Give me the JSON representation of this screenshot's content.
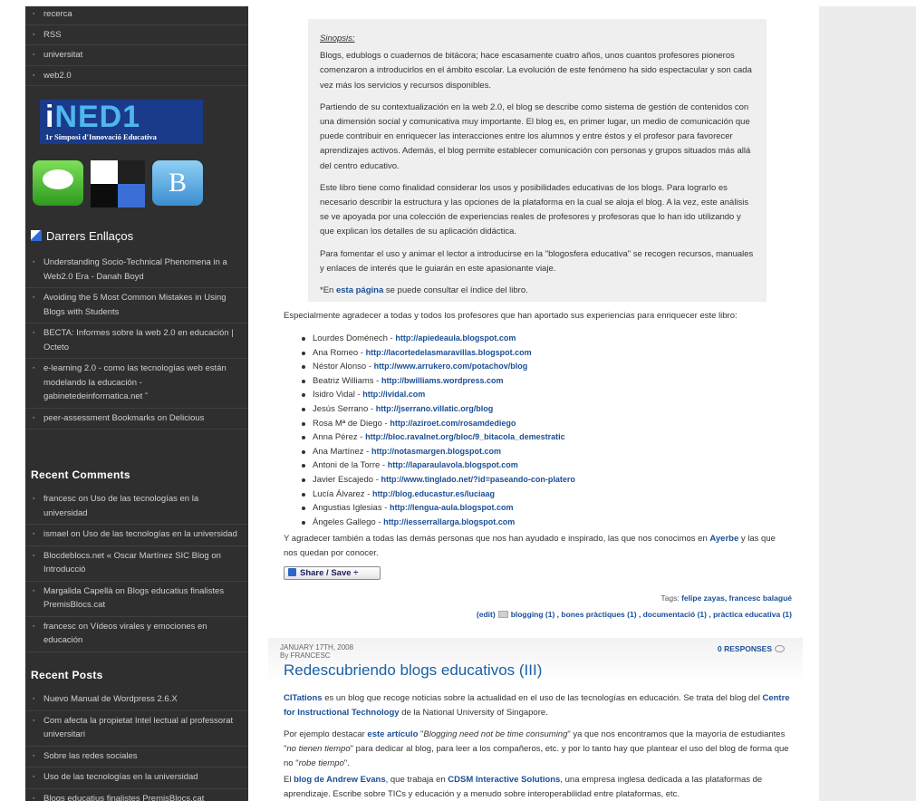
{
  "sidebar": {
    "top_links": [
      "recerca",
      "RSS",
      "universitat",
      "web2.0"
    ],
    "ned_logo": {
      "big_text_i": "i",
      "big_text_rest": "NED1",
      "sub": "1r Simposi d'Innovació Educativa"
    },
    "blogger_letter": "B",
    "links_heading": "Darrers Enllaços",
    "links": [
      "Understanding Socio-Technical Phenomena in a Web2.0 Era - Danah Boyd",
      "Avoiding the 5 Most Common Mistakes in Using Blogs with Students",
      "BECTA: Informes sobre la web 2.0 en educación | Octeto",
      "e-learning 2.0 - como las tecnologías web están modelando la educación - gabinetedeinformatica.net ˜",
      "peer-assessment Bookmarks on Delicious"
    ],
    "comments_heading": "Recent Comments",
    "comments": [
      "francesc on Uso de las tecnologías en la universidad",
      "ismael on Uso de las tecnologías en la universidad",
      "Blocdeblocs.net « Oscar Martínez SIC Blog on Introducció",
      "Margalida Capellà on Blogs educatius finalistes PremisBlocs.cat",
      "francesc on Vídeos virales y emociones en educación"
    ],
    "posts_heading": "Recent Posts",
    "posts": [
      "Nuevo Manual de Wordpress 2.6.X",
      "Com afecta la propietat Intel lectual al professorat universitari",
      "Sobre las redes sociales",
      "Uso de las tecnologías en la universidad",
      "Blogs educatius finalistes PremisBlocs.cat"
    ]
  },
  "synopsis": {
    "title": "Sinopsis:",
    "p1": "Blogs, edublogs o cuadernos de bitácora; hace escasamente cuatro años, unos cuantos profesores pioneros comenzaron a introducirlos en el ámbito escolar. La evolución de este fenómeno ha sido espectacular y son cada vez más los servicios y recursos disponibles.",
    "p2": "Partiendo de su contextualización en la web 2.0, el blog se describe como sistema de gestión de contenidos con una dimensión social y comunicativa muy importante. El blog es, en primer lugar, un medio de comunicación que puede contribuir en enriquecer las interacciones entre los alumnos y entre éstos y el profesor para favorecer aprendizajes activos. Además, el blog permite establecer comunicación con personas y grupos situados más allá del centro educativo.",
    "p3": "Este libro tiene como finalidad considerar los usos y posibilidades educativas de los blogs. Para lograrlo es necesario describir la estructura y las opciones de la plataforma en la cual se aloja el blog. A la vez, este análisis se ve apoyada por una colección de experiencias reales de profesores y profesoras que lo han ido utilizando y que explican los detalles de su aplicación didáctica.",
    "p4": "Para fomentar el uso y animar el lector a introducirse en la \"blogosfera educativa\" se recogen recursos, manuales y enlaces de interés que le guiarán en este apasionante viaje.",
    "p5_prefix": "*En ",
    "p5_link": "esta página",
    "p5_suffix": " se puede consultar el índice del libro."
  },
  "thanks_intro": "Especialmente agradecer a todas y todos los profesores que han aportado sus experiencias para enriquecer este libro:",
  "people": [
    {
      "name": "Lourdes Doménech - ",
      "url": "http://apiedeaula.blogspot.com"
    },
    {
      "name": "Ana Romeo - ",
      "url": "http://lacortedelasmaravillas.blogspot.com"
    },
    {
      "name": "Néstor Alonso - ",
      "url": "http://www.arrukero.com/potachov/blog"
    },
    {
      "name": "Beatriz Williams - ",
      "url": "http://bwilliams.wordpress.com"
    },
    {
      "name": "Isidro Vidal - ",
      "url": "http://ividal.com"
    },
    {
      "name": "Jesús Serrano - ",
      "url": "http://jserrano.villatic.org/blog"
    },
    {
      "name": "Rosa Mª de Diego - ",
      "url": "http://aziroet.com/rosamdediego"
    },
    {
      "name": "Anna Pérez - ",
      "url": "http://bloc.ravalnet.org/bloc/9_bitacola_demestratic"
    },
    {
      "name": "Ana Martínez - ",
      "url": "http://notasmargen.blogspot.com"
    },
    {
      "name": "Antoni de la Torre - ",
      "url": "http://laparaulavola.blogspot.com"
    },
    {
      "name": "Javier Escajedo - ",
      "url": "http://www.tinglado.net/?id=paseando-con-platero"
    },
    {
      "name": "Lucía Álvarez - ",
      "url": "http://blog.educastur.es/luciaag"
    },
    {
      "name": "Angustias Iglesias - ",
      "url": "http://lengua-aula.blogspot.com"
    },
    {
      "name": "Ángeles Gallego - ",
      "url": "http://iesserrallarga.blogspot.com"
    }
  ],
  "thanks_all": {
    "prefix": "Y agradecer también a todas las demás personas que nos han ayudado e inspirado, las que nos conocimos en ",
    "link": "Ayerbe",
    "suffix": " y las que nos quedan por conocer."
  },
  "share_label": "Share / Save ÷",
  "tags": {
    "label": "Tags: ",
    "values": "felipe zayas, francesc balagué"
  },
  "cats": {
    "edit": "(edit)",
    "items": "blogging (1) , bones pràctiques (1) , documentació (1) , pràctica educativa (1)"
  },
  "post": {
    "date": "JANUARY 17TH, 2008",
    "author": "By FRANCESC",
    "responses": "0 RESPONSES",
    "title": "Redescubriendo blogs educativos (III)",
    "p1": {
      "a1": "CITations",
      "t1": " es un blog que recoge noticias sobre la actualidad en el uso de las tecnologías en educación. Se trata del blog del ",
      "a2": "Centre for Instructional Technology",
      "t2": " de la National University of Singapore."
    },
    "p2": {
      "t1": "Por ejemplo destacar ",
      "a1": "este artículo",
      "t2": " \"",
      "i1": "Blogging need not be time consuming",
      "t3": "\" ya que nos encontramos que la mayoría de estudiantes \"",
      "i2": "no tienen tiempo",
      "t4": "\" para dedicar al blog, para leer a los compañeros, etc. y por lo tanto hay que plantear el uso del blog de forma que no \"",
      "i3": "robe tiempo",
      "t5": "\"."
    },
    "p3": {
      "t1": "El ",
      "a1": "blog de Andrew Evans",
      "t2": ", que trabaja en ",
      "a2": "CDSM Interactive Solutions",
      "t3": ", una empresa inglesa dedicada a las plataformas de aprendizaje. Escribe sobre TICs y educación y a menudo sobre interoperabilidad entre plataformas, etc."
    }
  },
  "colors": {
    "sidebar_bg": "#2f2f2f",
    "link_blue": "#1a4f96",
    "title_blue": "#1a5fa8",
    "synopsis_bg": "#efefef"
  }
}
